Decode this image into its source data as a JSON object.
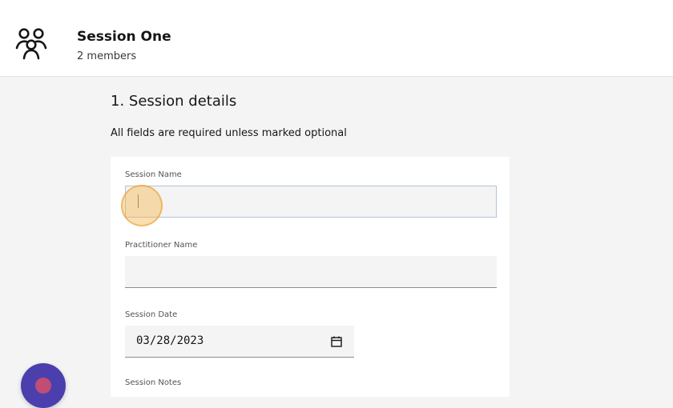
{
  "header": {
    "title": "Session One",
    "subtitle": "2 members",
    "icon": "group-icon"
  },
  "main": {
    "section_heading": "1. Session details",
    "section_note": "All fields are required unless marked optional",
    "fields": {
      "session_name": {
        "label": "Session Name",
        "value": "",
        "placeholder": ""
      },
      "practitioner_name": {
        "label": "Practitioner Name",
        "value": "",
        "placeholder": ""
      },
      "session_date": {
        "label": "Session Date",
        "value": "03/28/2023",
        "icon": "calendar-icon"
      },
      "session_notes": {
        "label": "Session Notes"
      }
    }
  },
  "colors": {
    "page_background": "#f4f4f4",
    "card_background": "#ffffff",
    "focus_outline": "#b4c2d8",
    "click_indicator": "#f5b246",
    "fab_background": "#4b3fae",
    "fab_accent": "#c04d73"
  },
  "floating_action": {
    "icon": "assistant-bubble-icon"
  }
}
